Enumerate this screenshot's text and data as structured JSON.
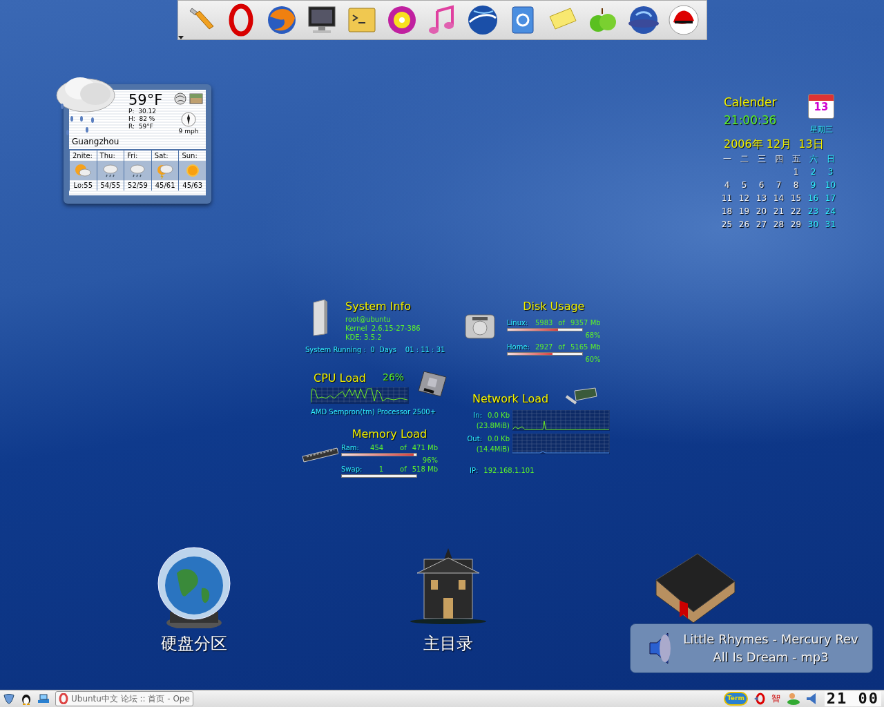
{
  "weather": {
    "temperature": "59°F",
    "readings": [
      "P:  30.12",
      "H:  82 %",
      "R:  59°F"
    ],
    "wind": "9 mph",
    "city": "Guangzhou",
    "forecast": [
      {
        "day": "2nite:",
        "kind": "partly-cloudy",
        "temps": "Lo:55"
      },
      {
        "day": "Thu:",
        "kind": "showers",
        "temps": "54/55"
      },
      {
        "day": "Fri:",
        "kind": "showers",
        "temps": "52/59"
      },
      {
        "day": "Sat:",
        "kind": "storm",
        "temps": "45/61"
      },
      {
        "day": "Sun:",
        "kind": "sunny",
        "temps": "45/63"
      }
    ]
  },
  "calendar": {
    "title": "Calender",
    "time": "21:00:36",
    "badge": "13",
    "weekday": "星期三",
    "date": "2006年 12月  13日",
    "headers": [
      {
        "text": "一",
        "weekend": false
      },
      {
        "text": "二",
        "weekend": false
      },
      {
        "text": "三",
        "weekend": false
      },
      {
        "text": "四",
        "weekend": false
      },
      {
        "text": "五",
        "weekend": false
      },
      {
        "text": "六",
        "weekend": true
      },
      {
        "text": "日",
        "weekend": true
      }
    ],
    "weeks": [
      [
        {
          "text": "1",
          "weekend": false
        },
        {
          "text": "2",
          "weekend": true
        },
        {
          "text": "3",
          "weekend": true
        }
      ],
      [
        {
          "text": "4",
          "weekend": false
        },
        {
          "text": "5",
          "weekend": false
        },
        {
          "text": "6",
          "weekend": false
        },
        {
          "text": "7",
          "weekend": false
        },
        {
          "text": "8",
          "weekend": false
        },
        {
          "text": "9",
          "weekend": true
        },
        {
          "text": "10",
          "weekend": true
        }
      ],
      [
        {
          "text": "11",
          "weekend": false
        },
        {
          "text": "12",
          "weekend": false
        },
        {
          "text": "13",
          "weekend": false
        },
        {
          "text": "14",
          "weekend": false
        },
        {
          "text": "15",
          "weekend": false
        },
        {
          "text": "16",
          "weekend": true
        },
        {
          "text": "17",
          "weekend": true
        }
      ],
      [
        {
          "text": "18",
          "weekend": false
        },
        {
          "text": "19",
          "weekend": false
        },
        {
          "text": "20",
          "weekend": false
        },
        {
          "text": "21",
          "weekend": false
        },
        {
          "text": "22",
          "weekend": false
        },
        {
          "text": "23",
          "weekend": true
        },
        {
          "text": "24",
          "weekend": true
        }
      ],
      [
        {
          "text": "25",
          "weekend": false
        },
        {
          "text": "26",
          "weekend": false
        },
        {
          "text": "27",
          "weekend": false
        },
        {
          "text": "28",
          "weekend": false
        },
        {
          "text": "29",
          "weekend": false
        },
        {
          "text": "30",
          "weekend": true
        },
        {
          "text": "31",
          "weekend": true
        }
      ]
    ]
  },
  "system_info": {
    "title": "System Info",
    "lines": [
      "root@ubuntu",
      "Kernel  2.6.15-27-386",
      "KDE: 3.5.2"
    ],
    "uptime": "System Running :  0  Days    01 : 11 : 31"
  },
  "disk_usage": {
    "title": "Disk Usage",
    "disks": [
      {
        "label": "Linux:",
        "used": "5983",
        "of": "of",
        "total": "9357 Mb",
        "level": 0.68,
        "percent": "68%"
      },
      {
        "label": "Home:",
        "used": "2927",
        "of": "of",
        "total": "5165 Mb",
        "level": 0.6,
        "percent": "60%"
      }
    ]
  },
  "cpu_load": {
    "title": "CPU Load",
    "percent": "26%",
    "processor": "AMD Sempron(tm) Processor 2500+"
  },
  "network_load": {
    "title": "Network Load",
    "in_label": "In:",
    "in_rate": "0.0 Kb",
    "in_total": "(23.8MiB)",
    "out_label": "Out:",
    "out_rate": "0.0 Kb",
    "out_total": "(14.4MiB)",
    "ip_label": "IP:",
    "ip": "192.168.1.101"
  },
  "memory_load": {
    "title": "Memory Load",
    "rows": [
      {
        "label": "Ram:",
        "used": "454",
        "of": "of",
        "total": "471 Mb",
        "level": 0.96,
        "percent": "96%"
      },
      {
        "label": "Swap:",
        "used": "1",
        "of": "of",
        "total": "518 Mb",
        "level": 0
      }
    ]
  },
  "desktop_icons": [
    {
      "label": "硬盘分区"
    },
    {
      "label": "主目录"
    }
  ],
  "notification": {
    "lines": [
      "Little Rhymes - Mercury Rev",
      "All Is Dream - mp3"
    ]
  },
  "taskbar": {
    "task": "Ubuntu中文 论坛 :: 首页 - Ope",
    "tray_term": "Term",
    "tray_char": "智",
    "clock": "21 00"
  }
}
